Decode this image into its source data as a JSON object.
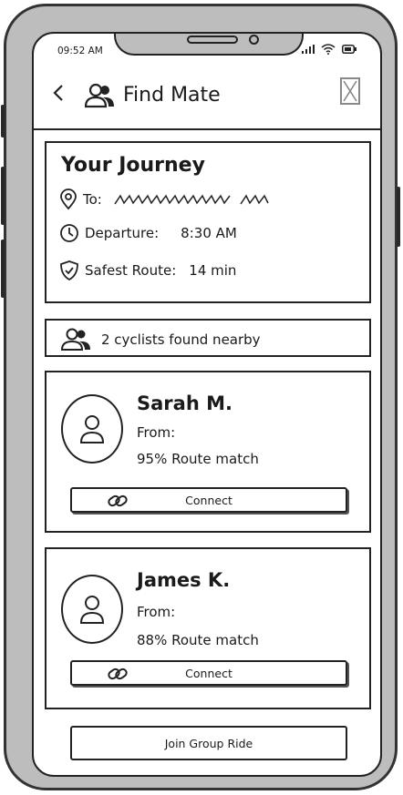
{
  "status_bar": {
    "time": "09:52 AM"
  },
  "header": {
    "title": "Find Mate"
  },
  "journey": {
    "title": "Your Journey",
    "to_label": "To:",
    "departure_label": "Departure:",
    "departure_value": "8:30 AM",
    "route_label": "Safest Route:",
    "route_value": "14 min"
  },
  "found": {
    "text": "2 cyclists found nearby"
  },
  "matches": [
    {
      "name": "Sarah M.",
      "from_label": "From:",
      "match_text": "95% Route match",
      "connect_label": "Connect"
    },
    {
      "name": "James K.",
      "from_label": "From:",
      "match_text": "88% Route match",
      "connect_label": "Connect"
    }
  ],
  "join_button": {
    "label": "Join Group Ride"
  },
  "icons": [
    "back-icon",
    "people-icon",
    "close-icon",
    "location-pin-icon",
    "clock-icon",
    "shield-check-icon",
    "person-icon",
    "link-icon",
    "signal-icon",
    "wifi-icon",
    "battery-icon"
  ]
}
